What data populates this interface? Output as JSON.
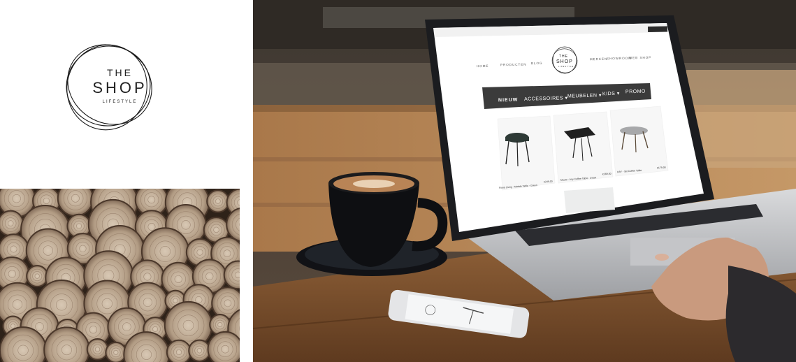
{
  "logo": {
    "line1": "THE",
    "line2": "SHOP",
    "line3": "LIFESTYLE"
  },
  "site": {
    "nav_left": [
      "HOME",
      "PRODUCTEN",
      "BLOG"
    ],
    "nav_right": [
      "MERKEN",
      "SHOWROOM",
      "WEB SHOP"
    ],
    "logo_line1": "THE",
    "logo_line2": "SHOP",
    "logo_line3": "LIFESTYLE",
    "menu": [
      "NIEUW",
      "ACCESSOIRES ▾",
      "MEUBELEN ▾",
      "KIDS ▾",
      "PROMO"
    ],
    "products": [
      {
        "name": "Fiona Living - Marble Table - Green",
        "price": "€249,00"
      },
      {
        "name": "Muuto - Airy Coffee Table - Zwart",
        "price": "€369,00"
      },
      {
        "name": "HAY - Slit Coffee Table",
        "price": "€179,00"
      }
    ]
  },
  "colors": {
    "menu_bar": "#3b3b3b",
    "wood_dark": "#3a2a1f",
    "wood_light": "#c9b7a3",
    "table_wood": "#8a5a33"
  }
}
